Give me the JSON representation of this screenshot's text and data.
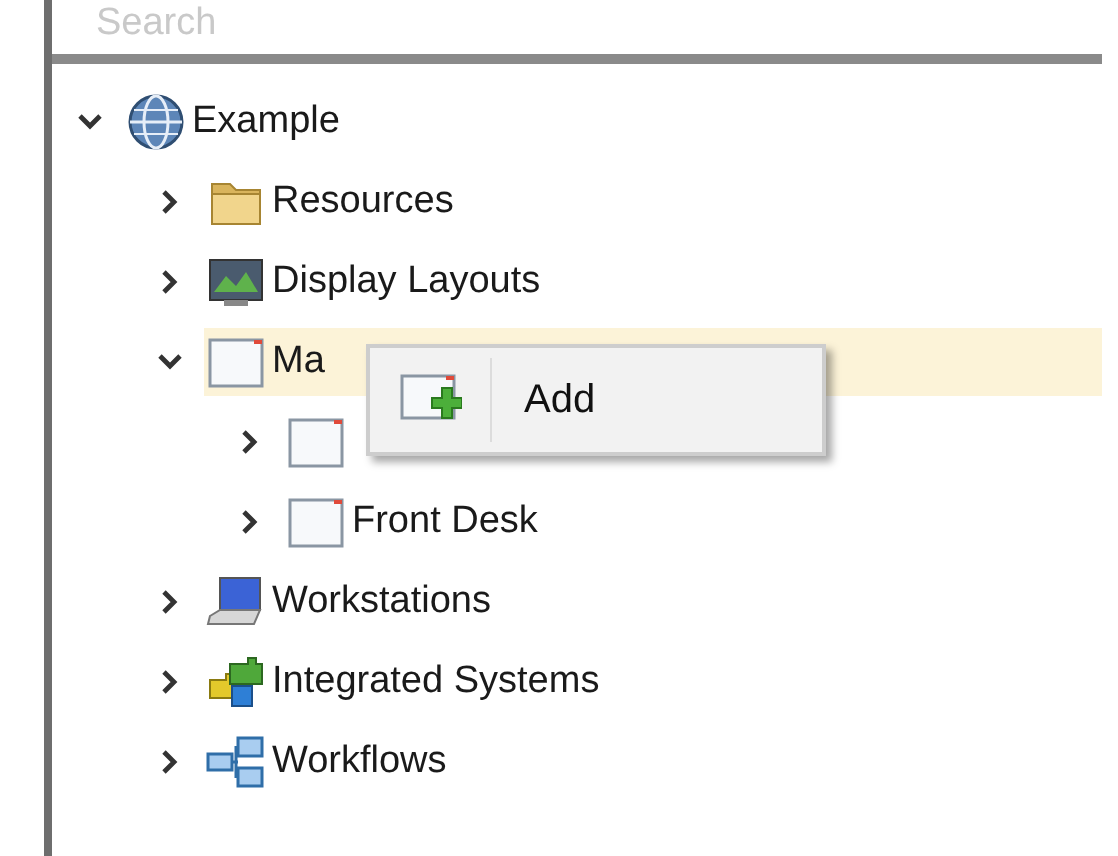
{
  "search": {
    "placeholder": "Search"
  },
  "tree": [
    {
      "label": "Example",
      "kind": "globe",
      "expanded": true,
      "selected": false,
      "children": [
        {
          "label": "Resources",
          "kind": "folder",
          "expanded": false,
          "selected": false
        },
        {
          "label": "Display Layouts",
          "kind": "display",
          "expanded": false,
          "selected": false
        },
        {
          "label": "Ma",
          "kind": "window",
          "expanded": true,
          "selected": true,
          "children": [
            {
              "kind": "window",
              "expanded": false,
              "selected": false
            },
            {
              "label": "Front Desk",
              "kind": "window",
              "expanded": false,
              "selected": false
            }
          ]
        },
        {
          "label": "Workstations",
          "kind": "laptop",
          "expanded": false,
          "selected": false
        },
        {
          "label": "Integrated Systems",
          "kind": "puzzle",
          "expanded": false,
          "selected": false
        },
        {
          "label": "Workflows",
          "kind": "workflow",
          "expanded": false,
          "selected": false
        }
      ]
    }
  ],
  "context_menu": {
    "items": [
      {
        "label": "Add",
        "kind": "add"
      }
    ]
  }
}
